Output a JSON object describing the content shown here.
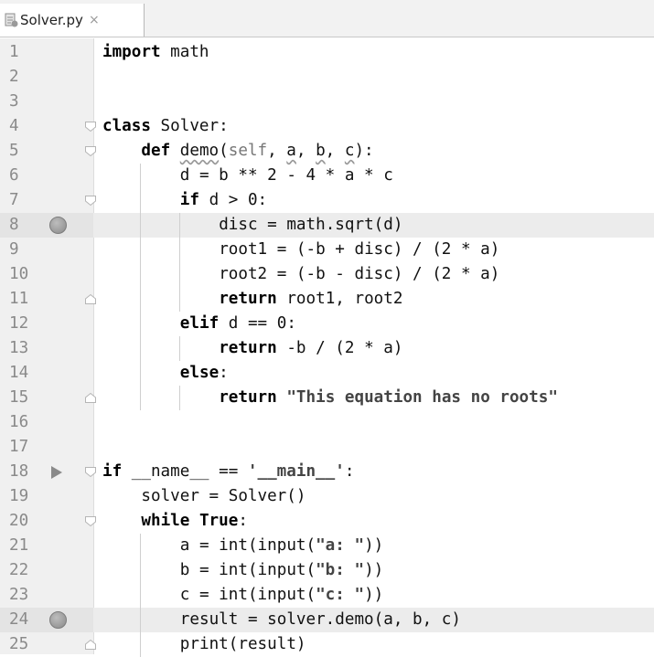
{
  "tab": {
    "filename": "Solver.py",
    "close": "×",
    "icon": "python-file-icon"
  },
  "lines": [
    {
      "n": "1",
      "bp": false,
      "run": false,
      "hl": false,
      "fold": "",
      "indent": 0,
      "parts": [
        {
          "t": "import",
          "c": "kw"
        },
        {
          "t": " math",
          "c": ""
        }
      ]
    },
    {
      "n": "2",
      "bp": false,
      "run": false,
      "hl": false,
      "fold": "",
      "indent": 0,
      "parts": []
    },
    {
      "n": "3",
      "bp": false,
      "run": false,
      "hl": false,
      "fold": "",
      "indent": 0,
      "parts": []
    },
    {
      "n": "4",
      "bp": false,
      "run": false,
      "hl": false,
      "fold": "open",
      "indent": 0,
      "parts": [
        {
          "t": "class",
          "c": "kw"
        },
        {
          "t": " Solver:",
          "c": ""
        }
      ]
    },
    {
      "n": "5",
      "bp": false,
      "run": false,
      "hl": false,
      "fold": "open",
      "indent": 1,
      "parts": [
        {
          "t": "def",
          "c": "kw"
        },
        {
          "t": " ",
          "c": ""
        },
        {
          "t": "demo",
          "c": "sq"
        },
        {
          "t": "(",
          "c": ""
        },
        {
          "t": "self",
          "c": "muted"
        },
        {
          "t": ", ",
          "c": ""
        },
        {
          "t": "a",
          "c": "sq"
        },
        {
          "t": ", ",
          "c": ""
        },
        {
          "t": "b",
          "c": "sq"
        },
        {
          "t": ", ",
          "c": ""
        },
        {
          "t": "c",
          "c": "sq"
        },
        {
          "t": "):",
          "c": ""
        }
      ]
    },
    {
      "n": "6",
      "bp": false,
      "run": false,
      "hl": false,
      "fold": "",
      "indent": 2,
      "parts": [
        {
          "t": "d = b ** 2 - 4 * a * c",
          "c": ""
        }
      ]
    },
    {
      "n": "7",
      "bp": false,
      "run": false,
      "hl": false,
      "fold": "open",
      "indent": 2,
      "parts": [
        {
          "t": "if",
          "c": "kw"
        },
        {
          "t": " d > 0:",
          "c": ""
        }
      ]
    },
    {
      "n": "8",
      "bp": true,
      "run": false,
      "hl": true,
      "fold": "",
      "indent": 3,
      "parts": [
        {
          "t": "disc = math.sqrt(d)",
          "c": ""
        }
      ]
    },
    {
      "n": "9",
      "bp": false,
      "run": false,
      "hl": false,
      "fold": "",
      "indent": 3,
      "parts": [
        {
          "t": "root1 = (-b + disc) / (2 * a)",
          "c": ""
        }
      ]
    },
    {
      "n": "10",
      "bp": false,
      "run": false,
      "hl": false,
      "fold": "",
      "indent": 3,
      "parts": [
        {
          "t": "root2 = (-b - disc) / (2 * a)",
          "c": ""
        }
      ]
    },
    {
      "n": "11",
      "bp": false,
      "run": false,
      "hl": false,
      "fold": "end",
      "indent": 3,
      "parts": [
        {
          "t": "return",
          "c": "kw"
        },
        {
          "t": " root1, root2",
          "c": ""
        }
      ]
    },
    {
      "n": "12",
      "bp": false,
      "run": false,
      "hl": false,
      "fold": "",
      "indent": 2,
      "parts": [
        {
          "t": "elif",
          "c": "kw"
        },
        {
          "t": " d == 0:",
          "c": ""
        }
      ]
    },
    {
      "n": "13",
      "bp": false,
      "run": false,
      "hl": false,
      "fold": "",
      "indent": 3,
      "parts": [
        {
          "t": "return",
          "c": "kw"
        },
        {
          "t": " -b / (2 * a)",
          "c": ""
        }
      ]
    },
    {
      "n": "14",
      "bp": false,
      "run": false,
      "hl": false,
      "fold": "",
      "indent": 2,
      "parts": [
        {
          "t": "else",
          "c": "kw"
        },
        {
          "t": ":",
          "c": ""
        }
      ]
    },
    {
      "n": "15",
      "bp": false,
      "run": false,
      "hl": false,
      "fold": "end",
      "indent": 3,
      "parts": [
        {
          "t": "return",
          "c": "kw"
        },
        {
          "t": " ",
          "c": ""
        },
        {
          "t": "\"This equation has no roots\"",
          "c": "str"
        }
      ]
    },
    {
      "n": "16",
      "bp": false,
      "run": false,
      "hl": false,
      "fold": "",
      "indent": 0,
      "parts": []
    },
    {
      "n": "17",
      "bp": false,
      "run": false,
      "hl": false,
      "fold": "",
      "indent": 0,
      "parts": []
    },
    {
      "n": "18",
      "bp": false,
      "run": true,
      "hl": false,
      "fold": "open",
      "indent": 0,
      "parts": [
        {
          "t": "if",
          "c": "kw"
        },
        {
          "t": " __name__ == ",
          "c": ""
        },
        {
          "t": "'__main__'",
          "c": "str"
        },
        {
          "t": ":",
          "c": ""
        }
      ]
    },
    {
      "n": "19",
      "bp": false,
      "run": false,
      "hl": false,
      "fold": "",
      "indent": 1,
      "parts": [
        {
          "t": "solver = Solver()",
          "c": ""
        }
      ]
    },
    {
      "n": "20",
      "bp": false,
      "run": false,
      "hl": false,
      "fold": "open",
      "indent": 1,
      "parts": [
        {
          "t": "while",
          "c": "kw"
        },
        {
          "t": " ",
          "c": ""
        },
        {
          "t": "True",
          "c": "kw"
        },
        {
          "t": ":",
          "c": ""
        }
      ]
    },
    {
      "n": "21",
      "bp": false,
      "run": false,
      "hl": false,
      "fold": "",
      "indent": 2,
      "parts": [
        {
          "t": "a = int(input(",
          "c": ""
        },
        {
          "t": "\"a: \"",
          "c": "str"
        },
        {
          "t": "))",
          "c": ""
        }
      ]
    },
    {
      "n": "22",
      "bp": false,
      "run": false,
      "hl": false,
      "fold": "",
      "indent": 2,
      "parts": [
        {
          "t": "b = int(input(",
          "c": ""
        },
        {
          "t": "\"b: \"",
          "c": "str"
        },
        {
          "t": "))",
          "c": ""
        }
      ]
    },
    {
      "n": "23",
      "bp": false,
      "run": false,
      "hl": false,
      "fold": "",
      "indent": 2,
      "parts": [
        {
          "t": "c = int(input(",
          "c": ""
        },
        {
          "t": "\"c: \"",
          "c": "str"
        },
        {
          "t": "))",
          "c": ""
        }
      ]
    },
    {
      "n": "24",
      "bp": true,
      "run": false,
      "hl": true,
      "fold": "",
      "indent": 2,
      "parts": [
        {
          "t": "result = solver.demo(a, b, c)",
          "c": ""
        }
      ]
    },
    {
      "n": "25",
      "bp": false,
      "run": false,
      "hl": false,
      "fold": "end",
      "indent": 2,
      "parts": [
        {
          "t": "print(result)",
          "c": ""
        }
      ]
    }
  ]
}
